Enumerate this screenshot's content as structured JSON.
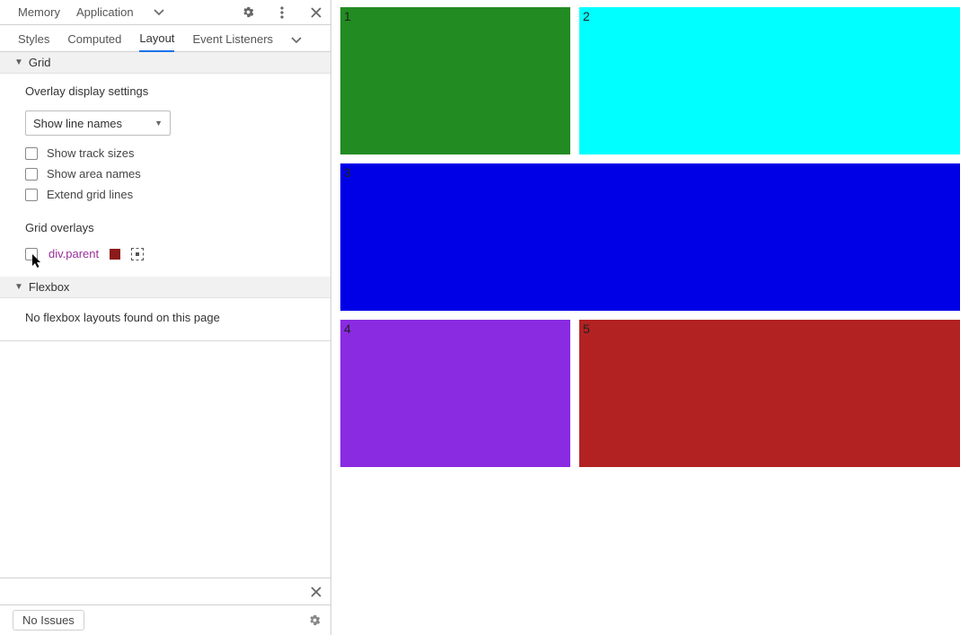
{
  "top_tabs": {
    "memory": "Memory",
    "application": "Application"
  },
  "sub_tabs": {
    "styles": "Styles",
    "computed": "Computed",
    "layout": "Layout",
    "event_listeners": "Event Listeners"
  },
  "grid_section": {
    "title": "Grid",
    "overlay_settings_title": "Overlay display settings",
    "select_value": "Show line names",
    "cb_track_sizes": "Show track sizes",
    "cb_area_names": "Show area names",
    "cb_extend_lines": "Extend grid lines",
    "overlays_title": "Grid overlays",
    "overlay_item_name": "div.parent",
    "overlay_item_color": "#8b1a1a"
  },
  "flexbox_section": {
    "title": "Flexbox",
    "empty_text": "No flexbox layouts found on this page"
  },
  "footer": {
    "no_issues": "No Issues"
  },
  "preview": {
    "cells": {
      "c1": "1",
      "c2": "2",
      "c3": "3",
      "c4": "4",
      "c5": "5"
    },
    "colors": {
      "c1": "#228B22",
      "c2": "#00FFFF",
      "c3": "#0000E6",
      "c4": "#8A2BE2",
      "c5": "#B22222"
    }
  }
}
